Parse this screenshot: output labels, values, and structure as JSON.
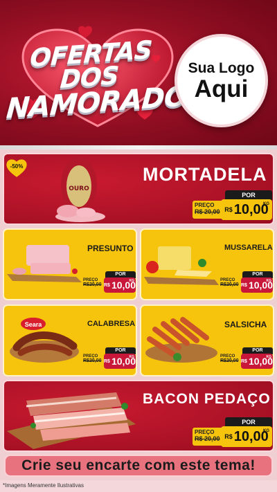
{
  "header": {
    "title_line1": "OFERTAS DOS",
    "title_line2": "NAMORADOS",
    "logo_line1": "Sua Logo",
    "logo_line2": "Aqui"
  },
  "badge": "-50%",
  "currency": "R$",
  "unit": "KG",
  "products": [
    {
      "name": "MORTADELA",
      "old_label": "PREÇO",
      "old_price": "R$ 20,00",
      "por": "POR",
      "price": "10,00"
    },
    {
      "name": "PRESUNTO",
      "old_label": "PREÇO",
      "old_price": "R$20,00",
      "por": "POR",
      "price": "10,00"
    },
    {
      "name": "MUSSARELA",
      "old_label": "PREÇO",
      "old_price": "R$20,00",
      "por": "POR",
      "price": "10,00"
    },
    {
      "name": "CALABRESA",
      "old_label": "PREÇO",
      "old_price": "R$20,00",
      "por": "POR",
      "price": "10,00"
    },
    {
      "name": "SALSICHA",
      "old_label": "PREÇO",
      "old_price": "R$20,00",
      "por": "POR",
      "price": "10,00"
    },
    {
      "name": "BACON PEDAÇO",
      "old_label": "PREÇO",
      "old_price": "R$ 20,00",
      "por": "POR",
      "price": "10,00"
    }
  ],
  "mortadela_brand": "OURO",
  "calabresa_brand": "Seara",
  "cta": "Crie seu encarte com este tema!",
  "footer": "*Imagens Meramente Ilustrativas",
  "colors": {
    "red": "#9a0d20",
    "yellow": "#f7c40d",
    "pink": "#e8737f"
  }
}
